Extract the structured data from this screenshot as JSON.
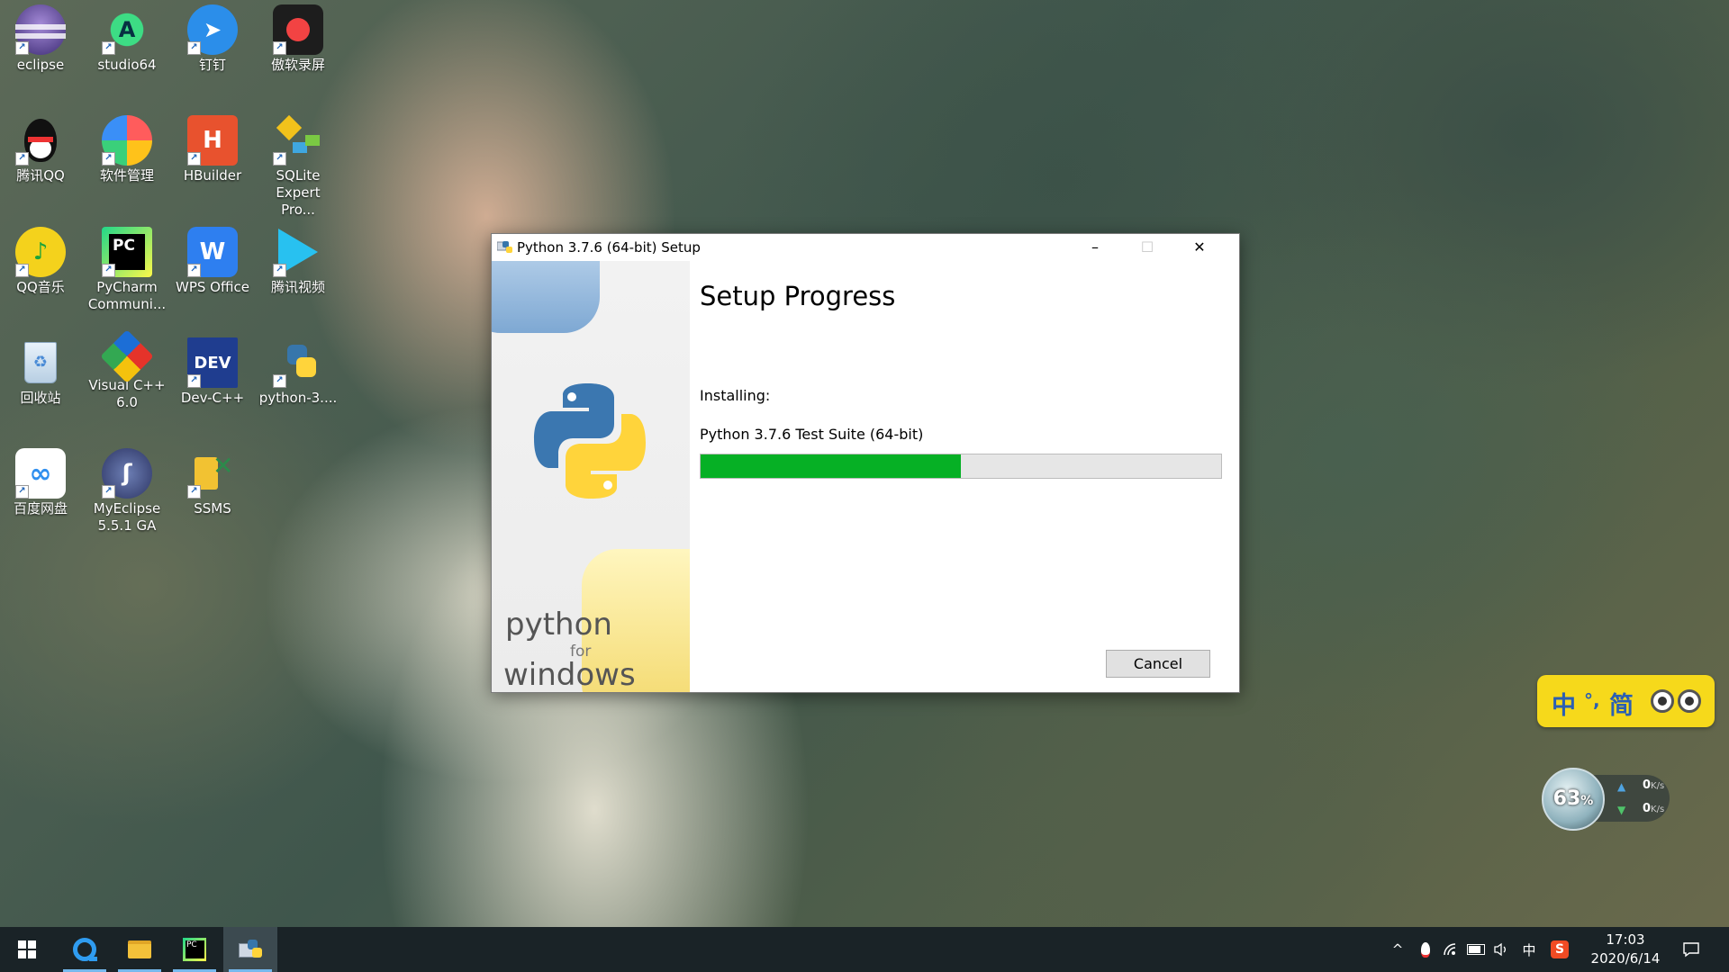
{
  "desktop": {
    "icons": [
      {
        "label": "eclipse"
      },
      {
        "label": "studio64"
      },
      {
        "label": "钉钉"
      },
      {
        "label": "傲软录屏"
      },
      {
        "label": "腾讯QQ"
      },
      {
        "label": "软件管理"
      },
      {
        "label": "HBuilder"
      },
      {
        "label": "SQLite Expert Pro..."
      },
      {
        "label": "QQ音乐"
      },
      {
        "label": "PyCharm Communi..."
      },
      {
        "label": "WPS Office"
      },
      {
        "label": "腾讯视频"
      },
      {
        "label": "回收站"
      },
      {
        "label": "Visual C++ 6.0"
      },
      {
        "label": "Dev-C++"
      },
      {
        "label": "python-3...."
      },
      {
        "label": "百度网盘"
      },
      {
        "label": "MyEclipse 5.5.1 GA"
      },
      {
        "label": "SSMS"
      }
    ]
  },
  "dialog": {
    "title": "Python 3.7.6 (64-bit) Setup",
    "heading": "Setup Progress",
    "installing_label": "Installing:",
    "package_name": "Python 3.7.6 Test Suite (64-bit)",
    "progress_fraction": 0.5,
    "cancel_label": "Cancel",
    "side_text": {
      "line1": "python",
      "line2": "for",
      "line3": "windows"
    },
    "controls": {
      "minimize": "–",
      "maximize": "☐",
      "close": "✕"
    }
  },
  "ime": {
    "chars": [
      "中",
      "°,",
      "简"
    ]
  },
  "net_monitor": {
    "percent": "63",
    "percent_sign": "%",
    "up": "0",
    "down": "0",
    "unit": "K/s"
  },
  "taskbar": {
    "apps": [
      "start-icon",
      "browser-icon",
      "file-explorer-icon",
      "pycharm-icon",
      "python-setup-icon"
    ],
    "tray": {
      "caret": "^",
      "lang": "中",
      "sogou": "S"
    },
    "clock": {
      "time": "17:03",
      "date": "2020/6/14"
    }
  },
  "colors": {
    "progress_fill": "#06b025",
    "taskbar": "#1a2327",
    "ime_bg": "#f6d91b"
  }
}
